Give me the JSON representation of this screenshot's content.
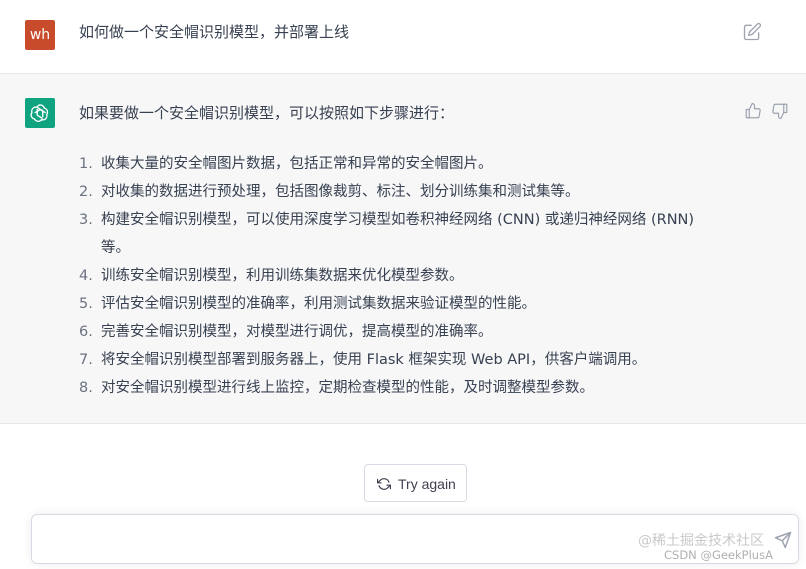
{
  "user_message": {
    "avatar_initials": "wh",
    "avatar_color": "#c84c2c",
    "text": "如何做一个安全帽识别模型，并部署上线"
  },
  "assistant_message": {
    "avatar_color": "#10a37f",
    "intro": "如果要做一个安全帽识别模型，可以按照如下步骤进行：",
    "steps": [
      {
        "num": "1.",
        "text": "收集大量的安全帽图片数据，包括正常和异常的安全帽图片。"
      },
      {
        "num": "2.",
        "text": "对收集的数据进行预处理，包括图像裁剪、标注、划分训练集和测试集等。"
      },
      {
        "num": "3.",
        "text": "构建安全帽识别模型，可以使用深度学习模型如卷积神经网络 (CNN) 或递归神经网络 (RNN) 等。"
      },
      {
        "num": "4.",
        "text": "训练安全帽识别模型，利用训练集数据来优化模型参数。"
      },
      {
        "num": "5.",
        "text": "评估安全帽识别模型的准确率，利用测试集数据来验证模型的性能。"
      },
      {
        "num": "6.",
        "text": "完善安全帽识别模型，对模型进行调优，提高模型的准确率。"
      },
      {
        "num": "7.",
        "text": "将安全帽识别模型部署到服务器上，使用 Flask 框架实现 Web API，供客户端调用。"
      },
      {
        "num": "8.",
        "text": "对安全帽识别模型进行线上监控，定期检查模型的性能，及时调整模型参数。"
      }
    ]
  },
  "try_again_label": "Try again",
  "watermark": {
    "line1": "@稀土掘金技术社区",
    "line2": "CSDN @GeekPlusA"
  }
}
